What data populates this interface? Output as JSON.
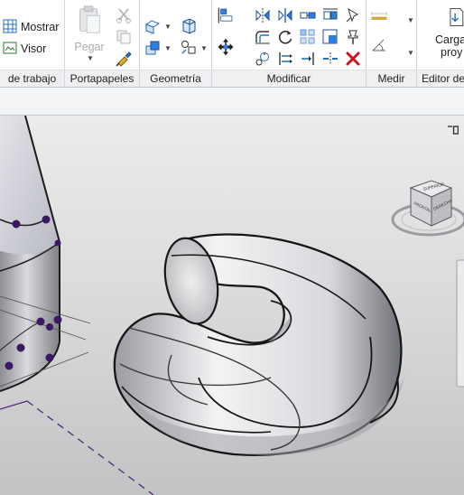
{
  "ribbon": {
    "workplane": {
      "label": "de trabajo",
      "show_label": "Mostrar",
      "viewer_label": "Visor"
    },
    "clipboard": {
      "label": "Portapapeles",
      "paste_label": "Pegar"
    },
    "geometry": {
      "label": "Geometría"
    },
    "modify": {
      "label": "Modificar"
    },
    "measure": {
      "label": "Medir"
    },
    "editor": {
      "label": "Editor de",
      "load_label_1": "Carga",
      "load_label_2": "proy"
    }
  },
  "colors": {
    "accent_blue": "#1f6fc5",
    "delete_red": "#d0121b",
    "measure_yellow": "#e0b030",
    "vertex_purple": "#3b1764",
    "disabled_gray": "#a9adb2"
  },
  "viewcube": {
    "face_top": "SUPERIOR",
    "face_front": "FRONTAL",
    "face_right": "DERECHA"
  }
}
